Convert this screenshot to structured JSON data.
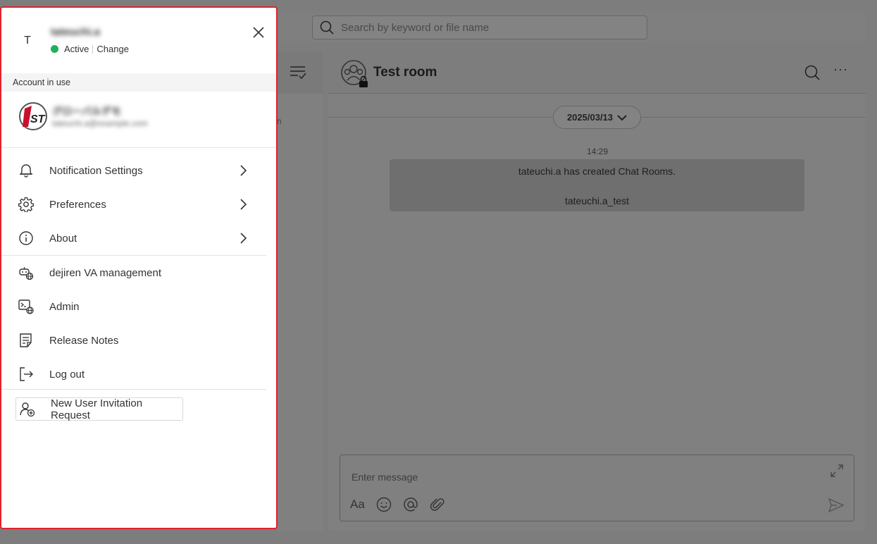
{
  "background": {
    "search": {
      "placeholder": "Search by keyword or file name"
    },
    "list_fragment": "n",
    "chat": {
      "room_title": "Test room",
      "date_label": "2025/03/13",
      "message_time": "14:29",
      "system_message_line1": "tateuchi.a has created Chat Rooms.",
      "system_message_line2": "tateuchi.a_test",
      "composer_placeholder": "Enter message",
      "format_label": "Aa"
    }
  },
  "drawer": {
    "avatar_initial": "T",
    "user_name": "tateuchi.a",
    "status_label": "Active",
    "change_label": "Change",
    "status_color": "#1fb05c",
    "border_color": "#e0232e",
    "section_label": "Account in use",
    "account": {
      "org_name": "グローバルデモ",
      "org_email": "tateuchi.a@example.com"
    },
    "menu_group1": [
      {
        "label": "Notification Settings",
        "icon": "bell-icon"
      },
      {
        "label": "Preferences",
        "icon": "gear-icon"
      },
      {
        "label": "About",
        "icon": "info-icon"
      }
    ],
    "menu_group2": [
      {
        "label": "dejiren VA management",
        "icon": "bot-globe-icon"
      },
      {
        "label": "Admin",
        "icon": "terminal-globe-icon"
      },
      {
        "label": "Release Notes",
        "icon": "notes-icon"
      },
      {
        "label": "Log out",
        "icon": "logout-icon"
      }
    ],
    "invite_label": "New User Invitation Request"
  }
}
